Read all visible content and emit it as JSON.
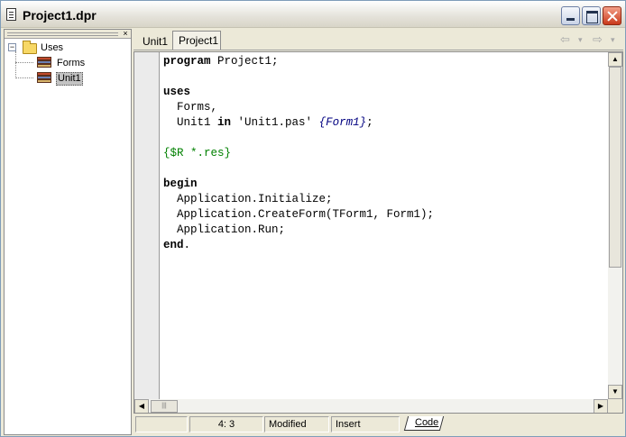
{
  "window": {
    "title": "Project1.dpr"
  },
  "explorer": {
    "close_glyph": "×",
    "tree": {
      "root": {
        "label": "Uses",
        "expanded_glyph": "−"
      },
      "children": [
        {
          "label": "Forms",
          "selected": false
        },
        {
          "label": "Unit1",
          "selected": true
        }
      ]
    }
  },
  "tabs": [
    {
      "label": "Unit1",
      "active": false
    },
    {
      "label": "Project1",
      "active": true
    }
  ],
  "navigation": {
    "back_glyph": "⇦",
    "back_dropdown_glyph": "▾",
    "forward_glyph": "⇨",
    "forward_dropdown_glyph": "▾"
  },
  "editor": {
    "lines": [
      [
        {
          "t": "program",
          "c": "kw"
        },
        {
          "t": " Project1;",
          "c": ""
        }
      ],
      [],
      [
        {
          "t": "uses",
          "c": "kw"
        }
      ],
      [
        {
          "t": "  Forms,",
          "c": ""
        }
      ],
      [
        {
          "t": "  Unit1 ",
          "c": ""
        },
        {
          "t": "in",
          "c": "kw"
        },
        {
          "t": " 'Unit1.pas' ",
          "c": "str"
        },
        {
          "t": "{Form1}",
          "c": "cm"
        },
        {
          "t": ";",
          "c": ""
        }
      ],
      [],
      [
        {
          "t": "{$R *.res}",
          "c": "dir"
        }
      ],
      [],
      [
        {
          "t": "begin",
          "c": "kw"
        }
      ],
      [
        {
          "t": "  Application.Initialize;",
          "c": ""
        }
      ],
      [
        {
          "t": "  Application.CreateForm(TForm1, Form1);",
          "c": ""
        }
      ],
      [
        {
          "t": "  Application.Run;",
          "c": ""
        }
      ],
      [
        {
          "t": "end",
          "c": "kw"
        },
        {
          "t": ".",
          "c": ""
        }
      ]
    ],
    "scroll_up_glyph": "▲",
    "scroll_down_glyph": "▼",
    "scroll_left_glyph": "◀",
    "scroll_right_glyph": "▶",
    "hthumb_grip": "|||"
  },
  "statusbar": {
    "position": "4:  3",
    "state": "Modified",
    "mode": "Insert",
    "view_tab": "Code"
  }
}
